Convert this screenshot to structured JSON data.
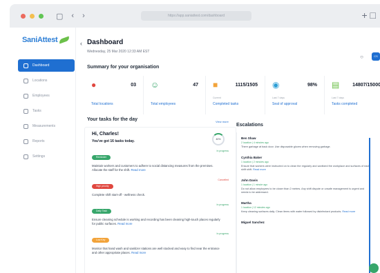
{
  "browser": {
    "address": "https://app.saniattest.com/dashboard"
  },
  "logo": {
    "text": "SaniAttest"
  },
  "sidebar": {
    "items": [
      {
        "label": "Dashboard",
        "active": true
      },
      {
        "label": "Locations"
      },
      {
        "label": "Employees"
      },
      {
        "label": "Tasks"
      },
      {
        "label": "Measurements"
      },
      {
        "label": "Reports"
      },
      {
        "label": "Settings"
      }
    ]
  },
  "header": {
    "title": "Dashboard",
    "date": "Wednesday, 25 Mar 2020 12:33 AM EST",
    "avatar": "CS"
  },
  "summary": {
    "title": "Summary for your organisation",
    "cards": [
      {
        "value": "03",
        "label": "Total locations",
        "sub": "",
        "color": "#e0473f"
      },
      {
        "value": "47",
        "label": "Total employees",
        "sub": "",
        "color": "#37a66b"
      },
      {
        "value": "1115/1505",
        "label": "Completed tasks",
        "sub": "Current",
        "color": "#f2a33a"
      },
      {
        "value": "98%",
        "label": "Seal of approval",
        "sub": "Last 7 days",
        "color": "#2e9fd6"
      },
      {
        "value": "14807/15000",
        "label": "Tasks completed",
        "sub": "Last 7 days",
        "color": "#6cc04a"
      }
    ]
  },
  "tasks": {
    "title": "Your tasks for the day",
    "view_all": "View more",
    "greeting": "Hi, Charles!",
    "subtitle": "You've got 16 tasks today.",
    "progress": "40%",
    "items": [
      {
        "tag": "Reminder",
        "tag_color": "#37a66b",
        "status": "In progress",
        "status_color": "#37a66b",
        "text": "Maintain workers and customers to adhere to social distancing measures from the premises. Allocate the staff for the shift.",
        "more": "Read more"
      },
      {
        "tag": "High priority",
        "tag_color": "#e0473f",
        "status": "Cancelled",
        "status_color": "#e0473f",
        "text": "Complete shift start-off - wellness check.",
        "more": ""
      },
      {
        "tag": "Daily Task",
        "tag_color": "#37a66b",
        "status": "In progress",
        "status_color": "#37a66b",
        "text": "Ensure cleaning schedule is working and recording has been cleaning high-touch places regularly for public surfaces.",
        "more": "Read more"
      },
      {
        "tag": "Low Key",
        "tag_color": "#f2a33a",
        "status": "In progress",
        "status_color": "#37a66b",
        "text": "Monitor that hand wash and sanitizer stations are well stocked and easy to find near the entrance and other appropriate places.",
        "more": "Read more"
      }
    ]
  },
  "escalations": {
    "title": "Escalations",
    "items": [
      {
        "name": "Ben Shaw",
        "meta": "2 location | 4 minutes ago",
        "text": "There garbage at back door. Use disposable gloves when removing garbage."
      },
      {
        "name": "Cynthia Baker",
        "meta": "1 location | 2 minutes ago",
        "text": "Ensure that workers were instructed on to clean the regularly and sanitized the workplace and surfaces of each shift shift.",
        "more": "Read more"
      },
      {
        "name": "John Davis",
        "meta": "1 location | 1 minute ago",
        "text": "Do not allow employees to be closer than 2 metres. Any shift dispute or unsafe management is urgent and needs to be addressed."
      },
      {
        "name": "Martha",
        "meta": "1 location | 12 minutes ago",
        "text": "Keep cleaning surfaces daily. Clean items with water followed by disinfectant products.",
        "more": "Read more"
      },
      {
        "name": "Miguel Sanchez",
        "meta": "",
        "text": ""
      }
    ]
  }
}
